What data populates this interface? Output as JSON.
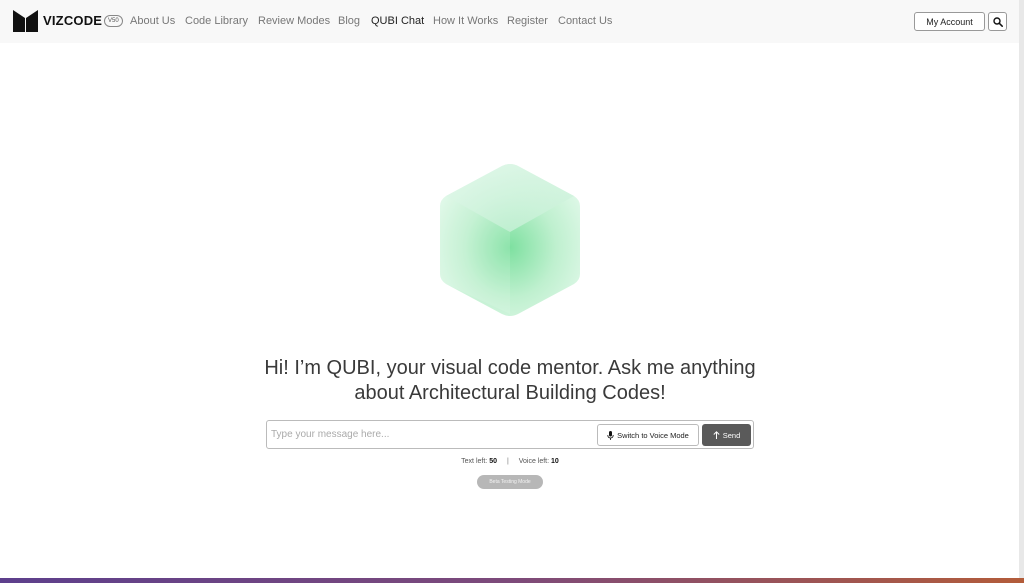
{
  "header": {
    "brand": "VIZCODE",
    "badge": "V50",
    "nav": [
      {
        "label": "About Us"
      },
      {
        "label": "Code Library"
      },
      {
        "label": "Review Modes"
      },
      {
        "label": "Blog"
      },
      {
        "label": "QUBI Chat",
        "active": true
      },
      {
        "label": "How It Works"
      },
      {
        "label": "Register"
      },
      {
        "label": "Contact Us"
      }
    ],
    "account_label": "My Account",
    "search_icon": "search-icon"
  },
  "hero": {
    "headline": "Hi! I’m QUBI, your visual code mentor. Ask me anything about Architectural Building Codes!"
  },
  "chat": {
    "placeholder": "Type your message here...",
    "voice_label": "Switch to Voice Mode",
    "send_label": "Send"
  },
  "counters": {
    "text_label": "Text left:",
    "text_value": "50",
    "divider": "|",
    "voice_label": "Voice left:",
    "voice_value": "10"
  },
  "beta_label": "Beta Testing Mode",
  "colors": {
    "topbar": "#f8f8f8",
    "send_button": "#5a5a5a",
    "cube_glow": "#7ee0a0",
    "bottom_gradient_start": "#5d3f8c",
    "bottom_gradient_end": "#b35c3a"
  }
}
